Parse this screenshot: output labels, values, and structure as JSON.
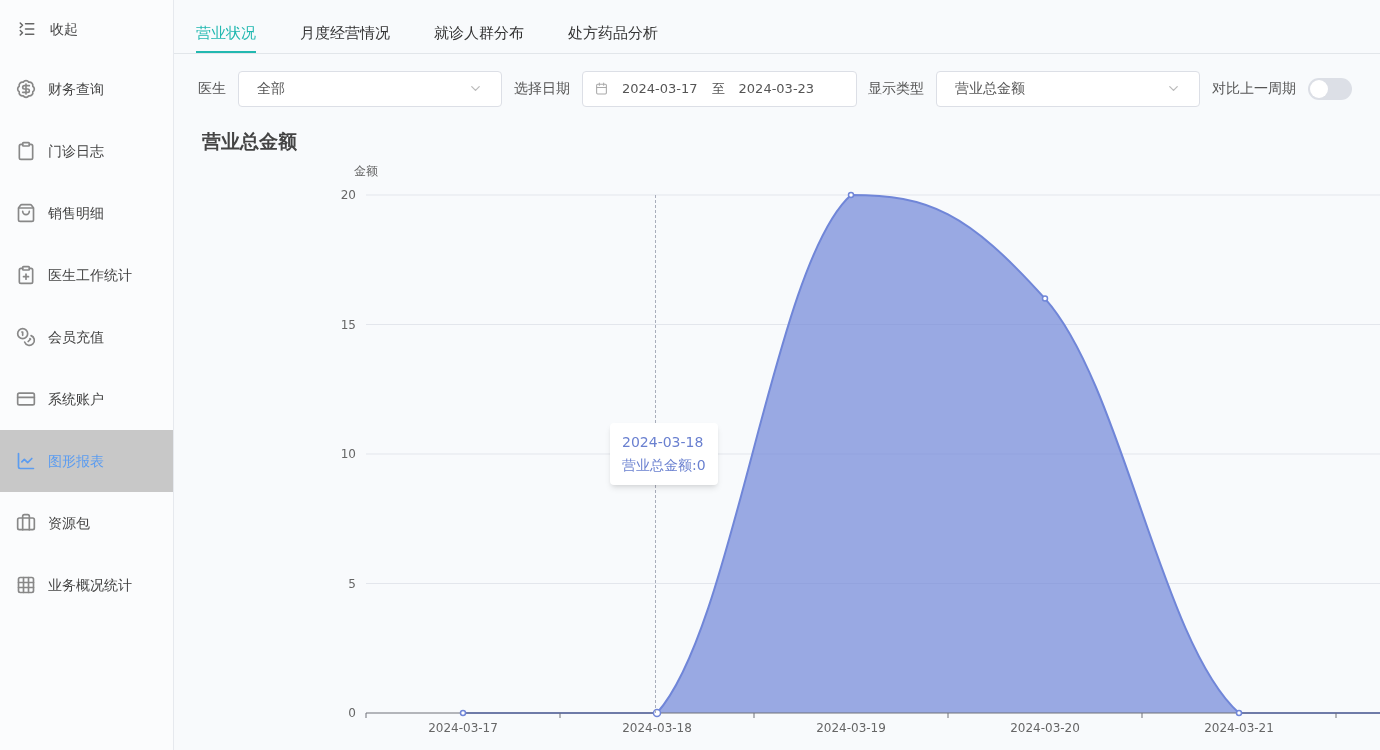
{
  "sidebar": {
    "collapse": "收起",
    "items": [
      {
        "label": "财务查询",
        "selected": false
      },
      {
        "label": "门诊日志",
        "selected": false
      },
      {
        "label": "销售明细",
        "selected": false
      },
      {
        "label": "医生工作统计",
        "selected": false
      },
      {
        "label": "会员充值",
        "selected": false
      },
      {
        "label": "系统账户",
        "selected": false
      },
      {
        "label": "图形报表",
        "selected": true
      },
      {
        "label": "资源包",
        "selected": false
      },
      {
        "label": "业务概况统计",
        "selected": false
      }
    ]
  },
  "tabs": [
    {
      "label": "营业状况",
      "selected": true
    },
    {
      "label": "月度经营情况",
      "selected": false
    },
    {
      "label": "就诊人群分布",
      "selected": false
    },
    {
      "label": "处方药品分析",
      "selected": false
    }
  ],
  "filters": {
    "doctor": {
      "label": "医生",
      "value": "全部"
    },
    "date": {
      "label": "选择日期",
      "start": "2024-03-17",
      "separator": "至",
      "end": "2024-03-23"
    },
    "type": {
      "label": "显示类型",
      "value": "营业总金额"
    },
    "compare": {
      "label": "对比上一周期",
      "on": false
    }
  },
  "chart": {
    "title": "营业总金额",
    "tooltip": {
      "date": "2024-03-18",
      "separator": ":",
      "value": "0"
    },
    "chart_data": {
      "type": "area",
      "ylabel": "金额",
      "categories": [
        "2024-03-17",
        "2024-03-18",
        "2024-03-19",
        "2024-03-20",
        "2024-03-21"
      ],
      "series": [
        {
          "name": "营业总金额",
          "color": "#7086d8",
          "values": [
            0,
            0,
            20,
            16,
            0
          ]
        }
      ],
      "ylim": [
        0,
        20
      ],
      "yticks": [
        0,
        5,
        10,
        15,
        20
      ],
      "grid": true
    }
  }
}
